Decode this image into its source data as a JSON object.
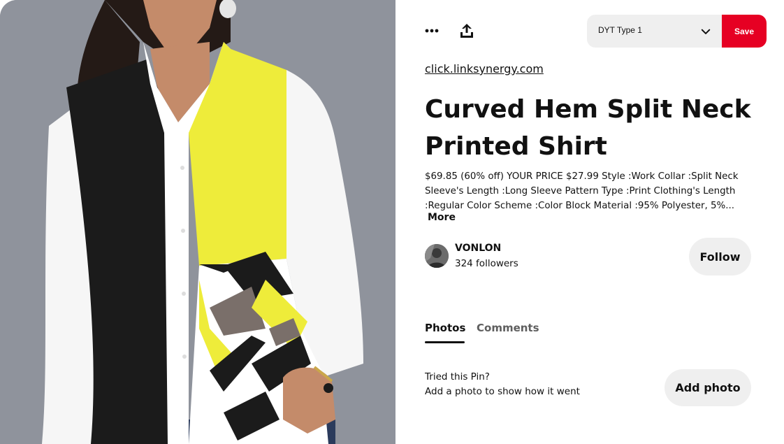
{
  "pin_image": {
    "colors": {
      "background": "#8f939c",
      "shirt_white": "#ffffff",
      "shirt_black": "#1b1b1b",
      "shirt_yellow": "#eeec3a",
      "accent_gray": "#7a6f6a",
      "skin": "#c48b6a",
      "hair": "#241a16"
    }
  },
  "toolbar": {
    "more_icon": "more-horizontal-icon",
    "share_icon": "share-icon",
    "board_select": "DYT Type 1",
    "save_label": "Save",
    "save_color": "#e60023"
  },
  "pin": {
    "source_link": "click.linksynergy.com",
    "title": "Curved Hem Split Neck Printed Shirt",
    "description": "$69.85 (60% off) YOUR PRICE $27.99 Style :Work Collar :Split Neck Sleeve's Length :Long Sleeve Pattern Type :Print Clothing's Length :Regular Color Scheme :Color Block Material :95% Polyester, 5%...",
    "more_label": "More"
  },
  "creator": {
    "name": "VONLON",
    "followers": "324 followers",
    "follow_label": "Follow"
  },
  "tabs": [
    {
      "label": "Photos",
      "active": true
    },
    {
      "label": "Comments",
      "active": false
    }
  ],
  "tried": {
    "line1": "Tried this Pin?",
    "line2": "Add a photo to show how it went",
    "button_label": "Add photo"
  }
}
